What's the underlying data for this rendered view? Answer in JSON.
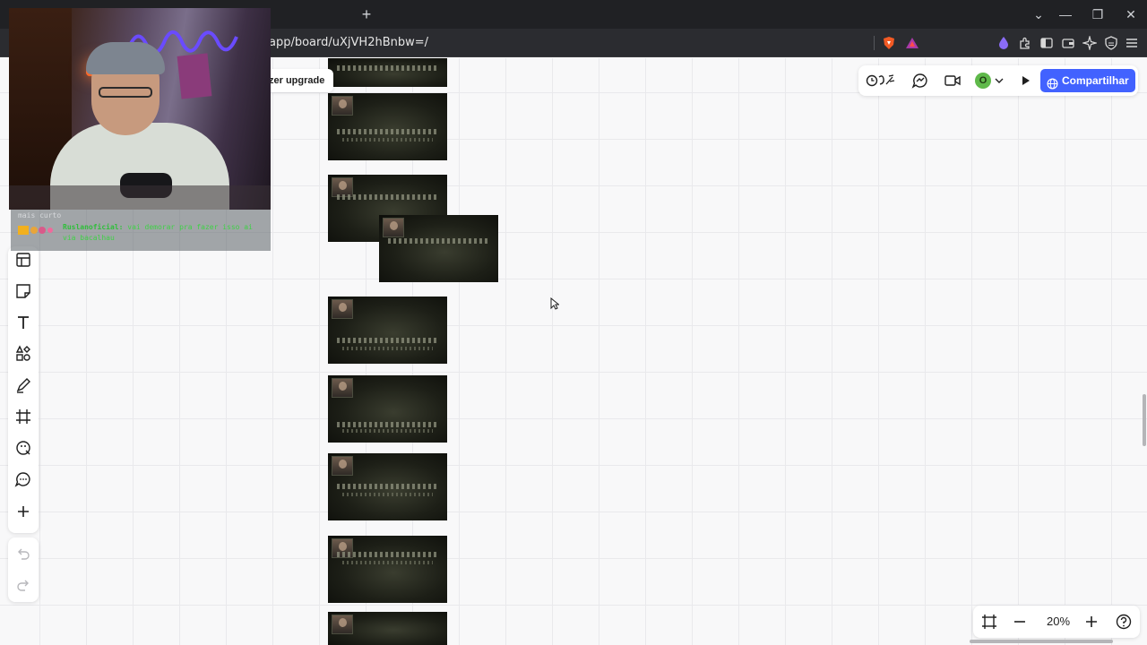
{
  "browser": {
    "url": "app/board/uXjVH2hBnbw=/",
    "new_tab_symbol": "+",
    "window_controls": [
      "⌄",
      "—",
      "❐",
      "✕"
    ]
  },
  "board": {
    "upgrade_label": "zer upgrade",
    "share_label": "Compartilhar",
    "avatar_initial": "O",
    "zoom_level": "20%",
    "accent_color": "#4262ff",
    "avatar_color": "#5fb94a",
    "frames_count": 9
  },
  "left_toolbar": {
    "tools": [
      "table-icon",
      "sticky-note-icon",
      "text-icon",
      "shapes-icon",
      "pen-icon",
      "frame-icon",
      "stamp-icon",
      "comment-icon",
      "add-icon"
    ],
    "history": [
      "undo-icon",
      "redo-icon"
    ]
  },
  "top_toolbar": {
    "icons": [
      "reactions-icon",
      "chat-icon",
      "video-icon",
      "chevron-down-icon",
      "play-icon",
      "globe-icon"
    ]
  },
  "zoom_controls": {
    "icons": [
      "fit-frame-icon",
      "zoom-out-icon",
      "zoom-in-icon",
      "help-icon"
    ]
  },
  "stream_overlay": {
    "chat_prev_line": "mais curto",
    "chat_user": "Ruslanoficial:",
    "chat_message": "vai demorar pra fazer isso ai via bacalhau"
  }
}
